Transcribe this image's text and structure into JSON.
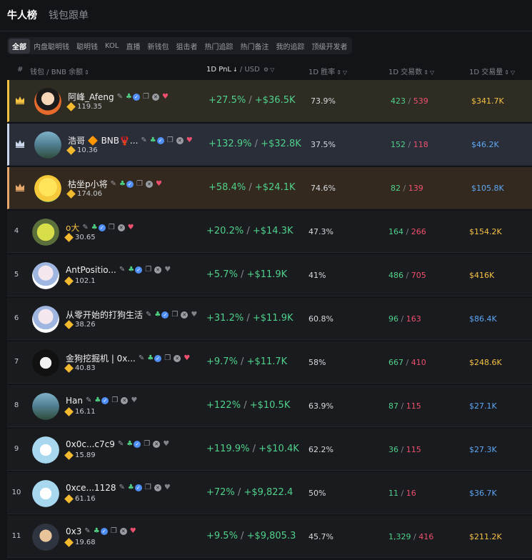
{
  "top_tabs": [
    {
      "label": "牛人榜",
      "active": true
    },
    {
      "label": "钱包跟单",
      "active": false
    }
  ],
  "filters": [
    {
      "label": "全部",
      "active": true
    },
    {
      "label": "内盘聪明钱",
      "active": false
    },
    {
      "label": "聪明钱",
      "active": false
    },
    {
      "label": "KOL",
      "active": false
    },
    {
      "label": "直播",
      "active": false
    },
    {
      "label": "新钱包",
      "active": false
    },
    {
      "label": "狙击者",
      "active": false
    },
    {
      "label": "热门追踪",
      "active": false
    },
    {
      "label": "热门备注",
      "active": false
    },
    {
      "label": "我的追踪",
      "active": false
    },
    {
      "label": "顶级开发者",
      "active": false
    }
  ],
  "columns": {
    "rank": "#",
    "wallet": "钱包 / BNB 余额",
    "pnl_main": "1D PnL",
    "pnl_sub": "/ USD",
    "winrate": "1D 胜率",
    "txs": "1D 交易数",
    "volume": "1D 交易量"
  },
  "colors": {
    "gain": "#4fd18b",
    "loss": "#f0506e",
    "gold": "#f5c242",
    "blue": "#5ea8f5",
    "bnb": "#f3ba2f",
    "rank1": "#f5c242",
    "rank2": "#c9d6ec",
    "rank3": "#e8a76a"
  },
  "rows": [
    {
      "rank": "1",
      "name": "阿峰_Afeng",
      "balance": "119.35",
      "pnl_pct": "+27.5%",
      "pnl_usd": "+$36.5K",
      "winrate": "73.9%",
      "buys": "423",
      "sells": "539",
      "volume": "$341.7K",
      "volume_color": "gold",
      "heart": true,
      "avatar_icon": "anime-boy-avatar"
    },
    {
      "rank": "2",
      "name": "浩哥 🔶 BNB🦞...",
      "balance": "10.36",
      "pnl_pct": "+132.9%",
      "pnl_usd": "+$32.8K",
      "winrate": "37.5%",
      "buys": "152",
      "sells": "118",
      "volume": "$46.2K",
      "volume_color": "blue",
      "heart": true,
      "avatar_icon": "landscape-avatar"
    },
    {
      "rank": "3",
      "name": "枯坐p小将",
      "balance": "174.06",
      "pnl_pct": "+58.4%",
      "pnl_usd": "+$24.1K",
      "winrate": "74.6%",
      "buys": "82",
      "sells": "139",
      "volume": "$105.8K",
      "volume_color": "blue",
      "heart": true,
      "avatar_icon": "yellow-character-avatar"
    },
    {
      "rank": "4",
      "name": "o大",
      "balance": "30.65",
      "pnl_pct": "+20.2%",
      "pnl_usd": "+$14.3K",
      "winrate": "47.3%",
      "buys": "164",
      "sells": "266",
      "volume": "$154.2K",
      "volume_color": "gold",
      "heart": true,
      "avatar_icon": "sponge-avatar"
    },
    {
      "rank": "5",
      "name": "AntPositio...",
      "balance": "102.1",
      "pnl_pct": "+5.7%",
      "pnl_usd": "+$11.9K",
      "winrate": "41%",
      "buys": "486",
      "sells": "705",
      "volume": "$416K",
      "volume_color": "gold",
      "heart": false,
      "avatar_icon": "anime-girl-avatar"
    },
    {
      "rank": "6",
      "name": "从零开始的打狗生活",
      "balance": "38.26",
      "pnl_pct": "+31.2%",
      "pnl_usd": "+$11.9K",
      "winrate": "60.8%",
      "buys": "96",
      "sells": "163",
      "volume": "$86.4K",
      "volume_color": "blue",
      "heart": false,
      "avatar_icon": "anime-girl-avatar"
    },
    {
      "rank": "7",
      "name": "金狗挖掘机 | 0x...",
      "balance": "40.83",
      "pnl_pct": "+9.7%",
      "pnl_usd": "+$11.7K",
      "winrate": "58%",
      "buys": "667",
      "sells": "410",
      "volume": "$248.6K",
      "volume_color": "gold",
      "heart": true,
      "avatar_icon": "manga-boy-avatar"
    },
    {
      "rank": "8",
      "name": "Han",
      "balance": "16.11",
      "pnl_pct": "+122%",
      "pnl_usd": "+$10.5K",
      "winrate": "63.9%",
      "buys": "87",
      "sells": "115",
      "volume": "$27.1K",
      "volume_color": "blue",
      "heart": false,
      "avatar_icon": "landscape-avatar"
    },
    {
      "rank": "9",
      "name": "0x0c...c7c9",
      "balance": "15.89",
      "pnl_pct": "+119.9%",
      "pnl_usd": "+$10.4K",
      "winrate": "62.2%",
      "buys": "36",
      "sells": "115",
      "volume": "$27.3K",
      "volume_color": "blue",
      "heart": false,
      "avatar_icon": "pixel-avatar"
    },
    {
      "rank": "10",
      "name": "0xce...1128",
      "balance": "61.16",
      "pnl_pct": "+72%",
      "pnl_usd": "+$9,822.4",
      "winrate": "50%",
      "buys": "11",
      "sells": "16",
      "volume": "$36.7K",
      "volume_color": "blue",
      "heart": false,
      "avatar_icon": "pixel-avatar"
    },
    {
      "rank": "11",
      "name": "0x3",
      "balance": "19.68",
      "pnl_pct": "+9.5%",
      "pnl_usd": "+$9,805.3",
      "winrate": "45.7%",
      "buys": "1,329",
      "sells": "416",
      "volume": "$211.2K",
      "volume_color": "gold",
      "heart": true,
      "avatar_icon": "cartoon-avatar"
    }
  ]
}
